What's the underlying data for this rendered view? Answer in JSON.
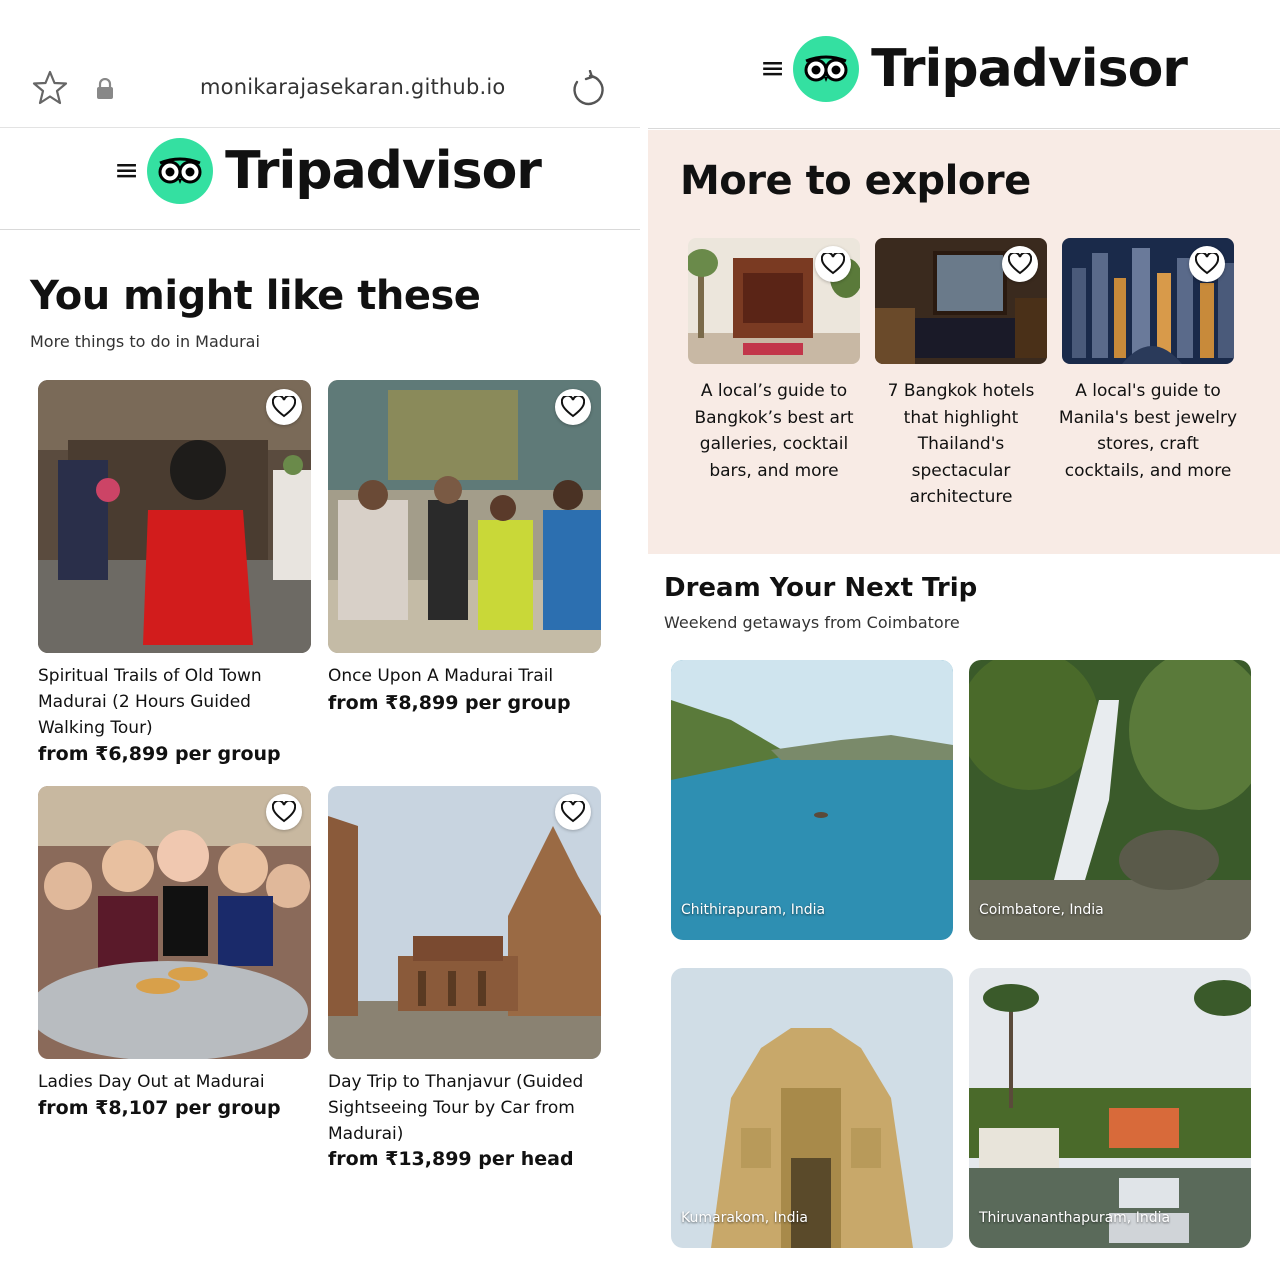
{
  "browser": {
    "url": "monikarajasekaran.github.io",
    "icons": [
      "star-icon",
      "lock-icon",
      "reload-icon"
    ]
  },
  "brand": {
    "menu_glyph": "≡",
    "name": "Tripadvisor",
    "logo_color": "#34e0a1"
  },
  "left": {
    "heading": "You might like these",
    "subheading": "More things to do in Madurai",
    "cards": [
      {
        "title": "Spiritual Trails of Old Town Madurai (2 Hours Guided Walking Tour)",
        "price": "from ₹6,899 per group"
      },
      {
        "title": "Once Upon A Madurai Trail",
        "price": "from ₹8,899 per group"
      },
      {
        "title": "Ladies Day Out at Madurai",
        "price": "from ₹8,107 per group"
      },
      {
        "title": "Day Trip to Thanjavur (Guided Sightseeing Tour by Car from Madurai)",
        "price": "from ₹13,899 per head"
      }
    ]
  },
  "right": {
    "explore_heading": "More to explore",
    "explore_bg": "#f8ebe5",
    "explore_items": [
      {
        "title": "A local’s guide to Bangkok’s best art galleries, cocktail bars, and more"
      },
      {
        "title": "7 Bangkok hotels that highlight Thailand's spectacular architecture"
      },
      {
        "title": "A local's guide to Manila's best jewelry stores, craft cocktails, and more"
      }
    ],
    "trip_heading": "Dream Your Next Trip",
    "trip_subheading": "Weekend getaways from Coimbatore",
    "trips": [
      {
        "label": "Chithirapuram, India"
      },
      {
        "label": "Coimbatore, India"
      },
      {
        "label": "Kumarakom, India"
      },
      {
        "label": "Thiruvananthapuram, India"
      }
    ]
  }
}
